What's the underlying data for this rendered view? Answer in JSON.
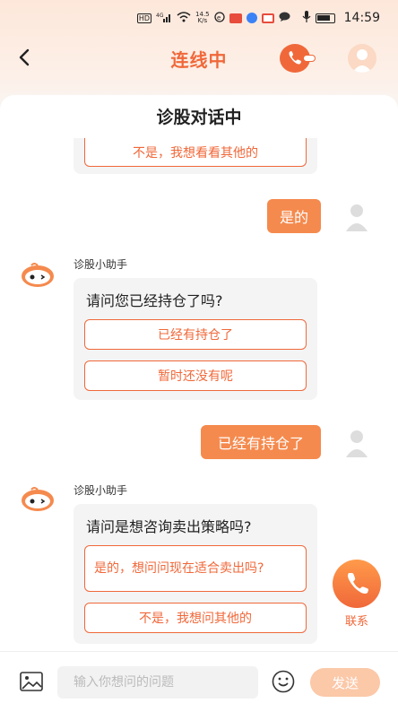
{
  "status_bar": {
    "net_speed": "14.5\nK/s",
    "time": "14:59"
  },
  "header": {
    "title": "连线中"
  },
  "chat": {
    "title": "诊股对话中",
    "partial_option": "不是，我想看看其他的",
    "bot_name": "诊股小助手",
    "messages": [
      {
        "from": "user",
        "text": "是的"
      },
      {
        "from": "bot",
        "question": "请问您已经持仓了吗?",
        "options": [
          "已经有持仓了",
          "暂时还没有呢"
        ]
      },
      {
        "from": "user",
        "text": "已经有持仓了"
      },
      {
        "from": "bot",
        "question": "请问是想咨询卖出策略吗?",
        "options": [
          "是的，想问问现在适合卖出吗?",
          "不是，我想问其他的"
        ]
      }
    ]
  },
  "float_contact": {
    "label": "联系"
  },
  "composer": {
    "placeholder": "输入你想问的问题",
    "send_label": "发送"
  },
  "colors": {
    "accent": "#f0683a",
    "user_bubble": "#f58a4e",
    "send_disabled": "#fbc8a8"
  }
}
